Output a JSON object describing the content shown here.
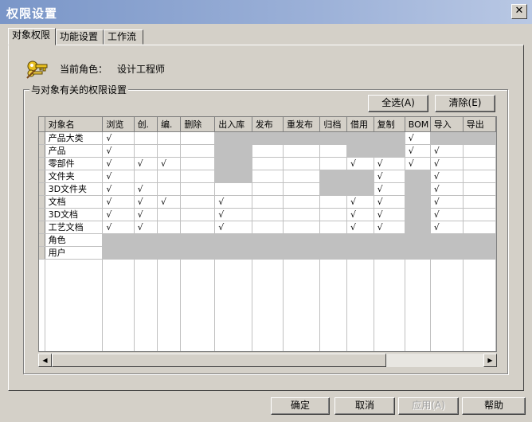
{
  "window": {
    "title": "权限设置",
    "close_glyph": "✕"
  },
  "tabs": [
    {
      "label": "对象权限",
      "active": true
    },
    {
      "label": "功能设置",
      "active": false
    },
    {
      "label": "工作流",
      "active": false
    }
  ],
  "role": {
    "label": "当前角色：",
    "value": "设计工程师",
    "icon": "key-icon"
  },
  "group": {
    "title": "与对象有关的权限设置"
  },
  "buttons": {
    "select_all": "全选(A)",
    "clear": "清除(E)",
    "ok": "确定",
    "cancel": "取消",
    "apply": "应用(A)",
    "help": "帮助"
  },
  "grid": {
    "columns": [
      "对象名",
      "浏览",
      "创.",
      "编.",
      "删除",
      "出入库",
      "发布",
      "重发布",
      "归档",
      "借用",
      "复制",
      "BOM",
      "导入",
      "导出"
    ],
    "rows": [
      {
        "name": "产品大类",
        "cells": [
          "√",
          "",
          "",
          "",
          "",
          "",
          "",
          "",
          "",
          "",
          "√",
          "",
          ""
        ]
      },
      {
        "name": "产品",
        "cells": [
          "√",
          "",
          "",
          "",
          "",
          "",
          "",
          "",
          "",
          "",
          "√",
          "√",
          ""
        ]
      },
      {
        "name": "零部件",
        "cells": [
          "√",
          "√",
          "√",
          "",
          "",
          "",
          "",
          "",
          "√",
          "√",
          "√",
          "√",
          ""
        ]
      },
      {
        "name": "文件夹",
        "cells": [
          "√",
          "",
          "",
          "",
          "",
          "",
          "",
          "",
          "",
          "√",
          "",
          "√",
          ""
        ]
      },
      {
        "name": "3D文件夹",
        "cells": [
          "√",
          "√",
          "",
          "",
          "",
          "",
          "",
          "",
          "",
          "√",
          "",
          "√",
          ""
        ]
      },
      {
        "name": "文档",
        "cells": [
          "√",
          "√",
          "√",
          "",
          "√",
          "",
          "",
          "",
          "√",
          "√",
          "",
          "√",
          ""
        ]
      },
      {
        "name": "3D文档",
        "cells": [
          "√",
          "√",
          "",
          "",
          "√",
          "",
          "",
          "",
          "√",
          "√",
          "",
          "√",
          ""
        ]
      },
      {
        "name": "工艺文档",
        "cells": [
          "√",
          "√",
          "",
          "",
          "√",
          "",
          "",
          "",
          "√",
          "√",
          "",
          "√",
          ""
        ]
      },
      {
        "name": "角色",
        "cells": [
          "",
          "",
          "",
          "",
          "",
          "",
          "",
          "",
          "",
          "",
          "",
          "",
          ""
        ]
      },
      {
        "name": "用户",
        "cells": [
          "",
          "",
          "",
          "",
          "",
          "",
          "",
          "",
          "",
          "",
          "",
          "",
          ""
        ]
      }
    ],
    "disabled_cells": [
      [
        0,
        4
      ],
      [
        0,
        5
      ],
      [
        0,
        6
      ],
      [
        0,
        7
      ],
      [
        0,
        8
      ],
      [
        0,
        9
      ],
      [
        0,
        11
      ],
      [
        0,
        12
      ],
      [
        1,
        4
      ],
      [
        1,
        8
      ],
      [
        1,
        9
      ],
      [
        2,
        4
      ],
      [
        3,
        4
      ],
      [
        3,
        7
      ],
      [
        3,
        8
      ],
      [
        3,
        10
      ],
      [
        4,
        7
      ],
      [
        4,
        8
      ],
      [
        4,
        10
      ],
      [
        5,
        10
      ],
      [
        6,
        10
      ],
      [
        7,
        10
      ],
      [
        8,
        0
      ],
      [
        8,
        1
      ],
      [
        8,
        2
      ],
      [
        8,
        3
      ],
      [
        8,
        4
      ],
      [
        8,
        5
      ],
      [
        8,
        6
      ],
      [
        8,
        7
      ],
      [
        8,
        8
      ],
      [
        8,
        9
      ],
      [
        8,
        10
      ],
      [
        8,
        11
      ],
      [
        8,
        12
      ],
      [
        9,
        0
      ],
      [
        9,
        1
      ],
      [
        9,
        2
      ],
      [
        9,
        3
      ],
      [
        9,
        4
      ],
      [
        9,
        5
      ],
      [
        9,
        6
      ],
      [
        9,
        7
      ],
      [
        9,
        8
      ],
      [
        9,
        9
      ],
      [
        9,
        10
      ],
      [
        9,
        11
      ],
      [
        9,
        12
      ]
    ]
  },
  "scrollbar": {
    "left_arrow": "◀",
    "right_arrow": "▶"
  }
}
